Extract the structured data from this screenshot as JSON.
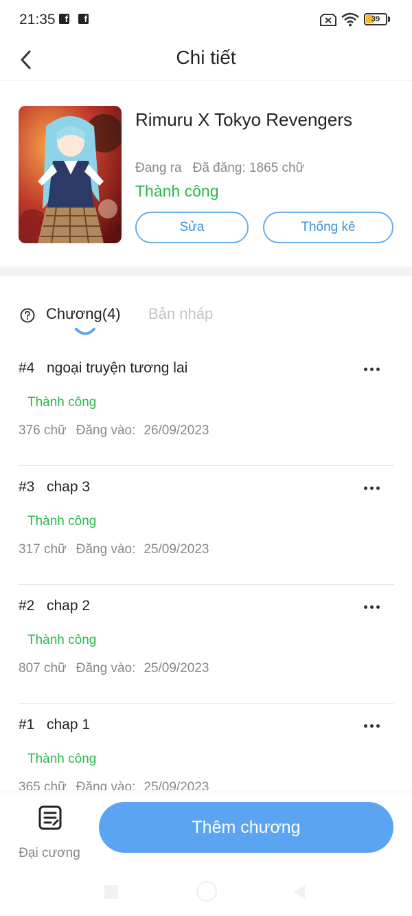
{
  "status_bar": {
    "time": "21:35",
    "battery_level": "39",
    "battery_fill_fraction": 0.39,
    "icons": [
      "facebook-icon",
      "facebook-icon",
      "no-sim-icon",
      "wifi-icon",
      "battery-icon"
    ]
  },
  "header": {
    "title": "Chi tiết",
    "back_icon": "chevron-left-icon"
  },
  "story": {
    "title": "Rimuru X Tokyo Revengers",
    "state": "Đang ra",
    "published_words": "Đã đăng: 1865 chữ",
    "status": "Thành công",
    "edit_label": "Sửa",
    "stats_label": "Thống kê"
  },
  "tabs": {
    "chapters_label": "Chương(4)",
    "drafts_label": "Bản nháp"
  },
  "chapters": [
    {
      "number": "#4",
      "title": "ngoại truyện tương lai",
      "status": "Thành công",
      "words": "376 chữ",
      "posted_label": "Đăng vào:",
      "date": "26/09/2023"
    },
    {
      "number": "#3",
      "title": "chap 3",
      "status": "Thành công",
      "words": "317 chữ",
      "posted_label": "Đăng vào:",
      "date": "25/09/2023"
    },
    {
      "number": "#2",
      "title": "chap 2",
      "status": "Thành công",
      "words": "807 chữ",
      "posted_label": "Đăng vào:",
      "date": "25/09/2023"
    },
    {
      "number": "#1",
      "title": "chap 1",
      "status": "Thành công",
      "words": "365 chữ",
      "posted_label": "Đăng vào:",
      "date": "25/09/2023"
    }
  ],
  "bottom": {
    "outline_label": "Đại cương",
    "add_chapter_label": "Thêm chương"
  },
  "colors": {
    "accent": "#5ba4f2",
    "success": "#2db84a",
    "muted": "#888888",
    "outline_button": "#6aaee9"
  }
}
